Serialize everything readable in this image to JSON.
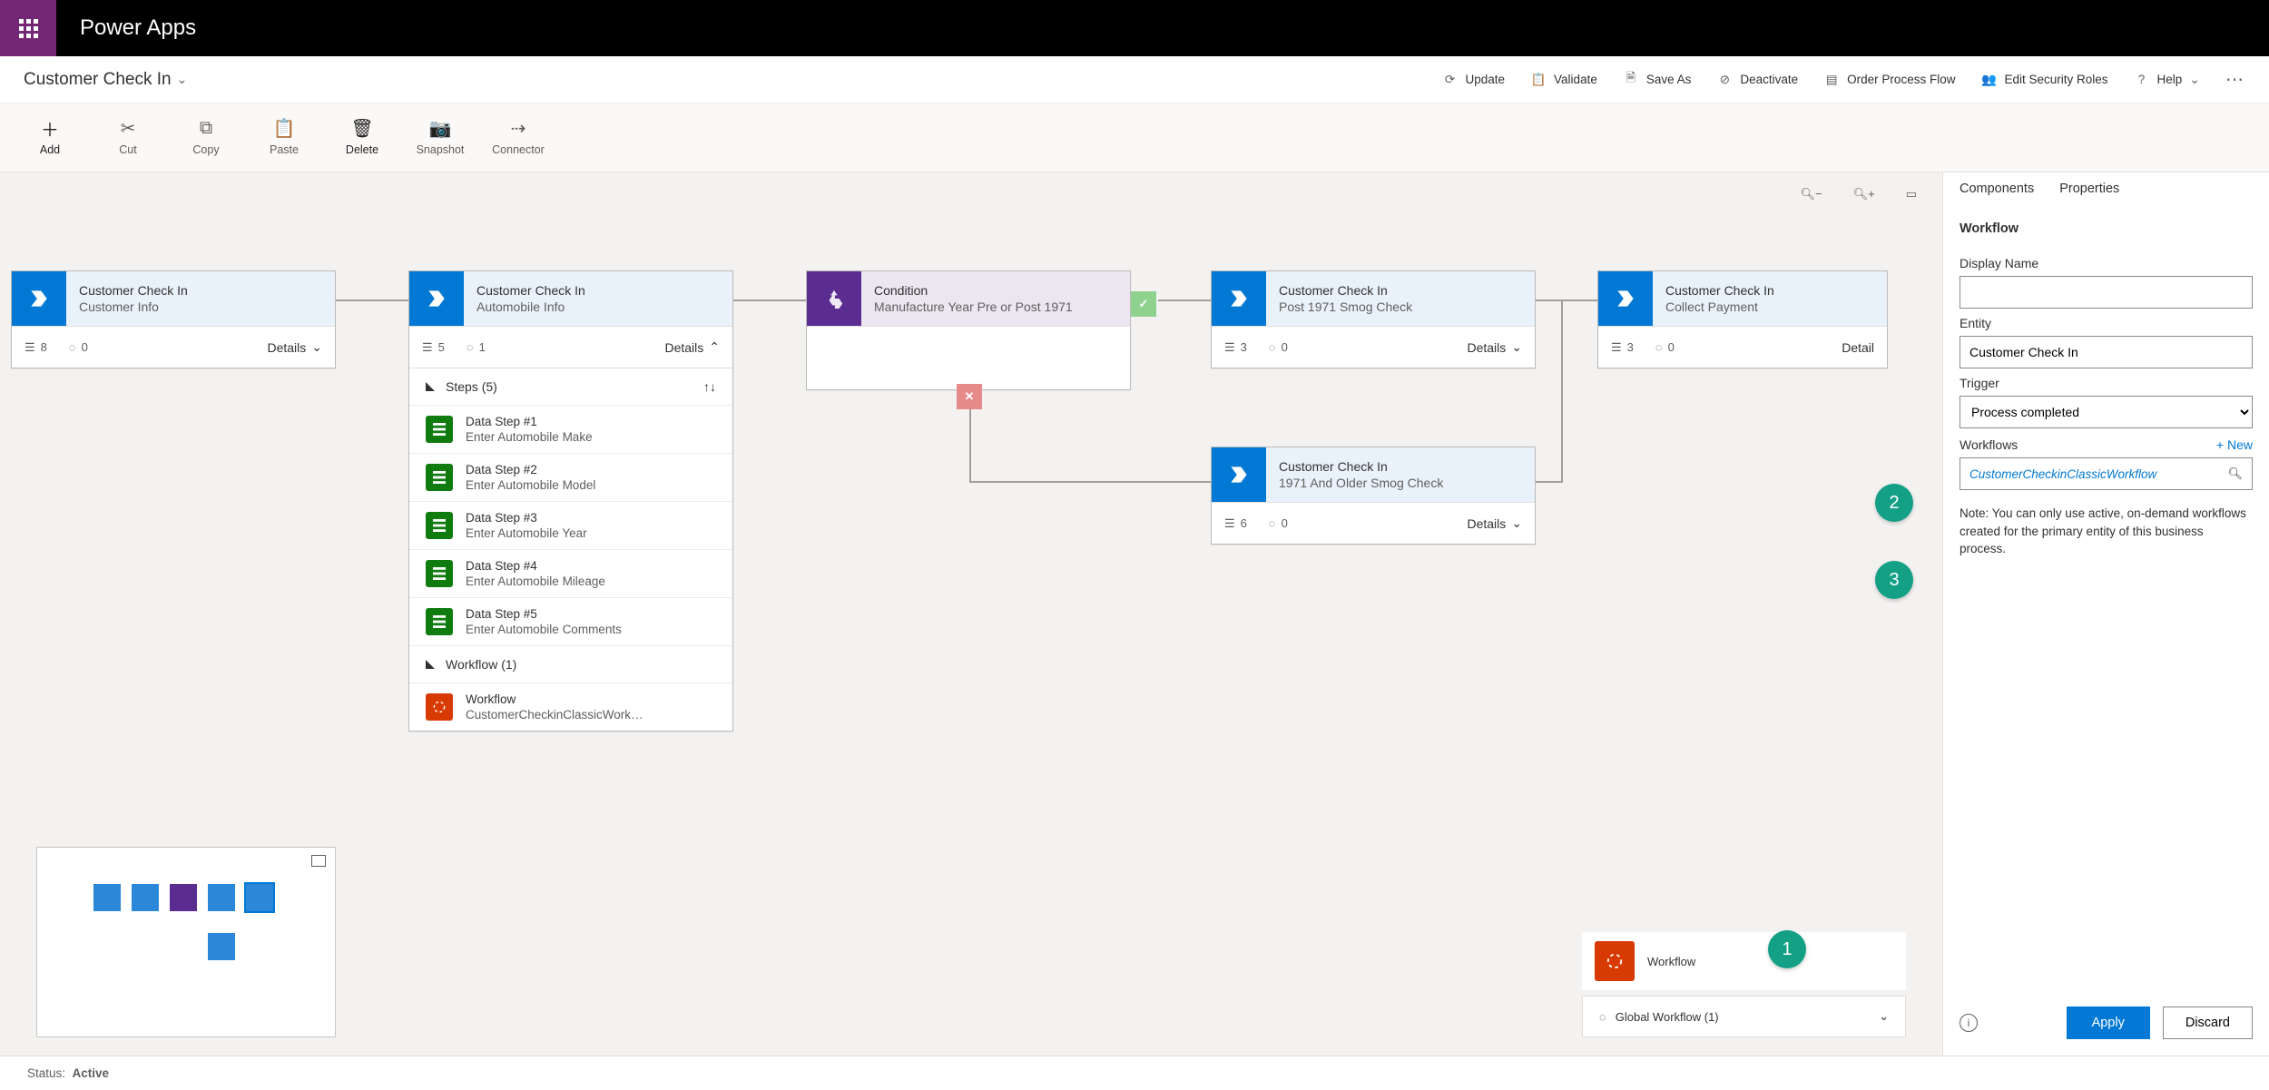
{
  "header": {
    "brand": "Power Apps"
  },
  "cmdrow": {
    "title": "Customer Check In",
    "actions": {
      "update": "Update",
      "validate": "Validate",
      "saveas": "Save As",
      "deactivate": "Deactivate",
      "order": "Order Process Flow",
      "security": "Edit Security Roles",
      "help": "Help"
    }
  },
  "toolbar": {
    "add": "Add",
    "cut": "Cut",
    "copy": "Copy",
    "paste": "Paste",
    "delete": "Delete",
    "snapshot": "Snapshot",
    "connector": "Connector"
  },
  "stages": {
    "s1": {
      "title": "Customer Check In",
      "sub": "Customer Info",
      "steps": "8",
      "wf": "0",
      "details": "Details"
    },
    "s2": {
      "title": "Customer Check In",
      "sub": "Automobile Info",
      "steps": "5",
      "wf": "1",
      "details": "Details",
      "steps_label": "Steps (5)",
      "rows": [
        {
          "t": "Data Step #1",
          "d": "Enter Automobile Make"
        },
        {
          "t": "Data Step #2",
          "d": "Enter Automobile Model"
        },
        {
          "t": "Data Step #3",
          "d": "Enter Automobile Year"
        },
        {
          "t": "Data Step #4",
          "d": "Enter Automobile Mileage"
        },
        {
          "t": "Data Step #5",
          "d": "Enter Automobile Comments"
        }
      ],
      "wf_label": "Workflow (1)",
      "wf_row": {
        "t": "Workflow",
        "d": "CustomerCheckinClassicWork…"
      }
    },
    "cond": {
      "title": "Condition",
      "sub": "Manufacture Year Pre or Post 1971"
    },
    "s3": {
      "title": "Customer Check In",
      "sub": "Post 1971 Smog Check",
      "steps": "3",
      "wf": "0",
      "details": "Details"
    },
    "s4": {
      "title": "Customer Check In",
      "sub": "1971 And Older Smog Check",
      "steps": "6",
      "wf": "0",
      "details": "Details"
    },
    "s5": {
      "title": "Customer Check In",
      "sub": "Collect Payment",
      "steps": "3",
      "wf": "0",
      "details": "Detail"
    }
  },
  "gw": {
    "title": "Workflow",
    "footer": "Global Workflow (1)"
  },
  "panel": {
    "tabs": {
      "components": "Components",
      "properties": "Properties"
    },
    "section": "Workflow",
    "display_name_label": "Display Name",
    "display_name_value": "",
    "entity_label": "Entity",
    "entity_value": "Customer Check In",
    "trigger_label": "Trigger",
    "trigger_value": "Process completed",
    "workflows_label": "Workflows",
    "new_link": "+ New",
    "search_value": "CustomerCheckinClassicWorkflow",
    "note": "Note: You can only use active, on-demand workflows created for the primary entity of this business process.",
    "apply": "Apply",
    "discard": "Discard"
  },
  "callouts": {
    "c1": "1",
    "c2": "2",
    "c3": "3"
  },
  "status": {
    "label": "Status:",
    "value": "Active"
  }
}
